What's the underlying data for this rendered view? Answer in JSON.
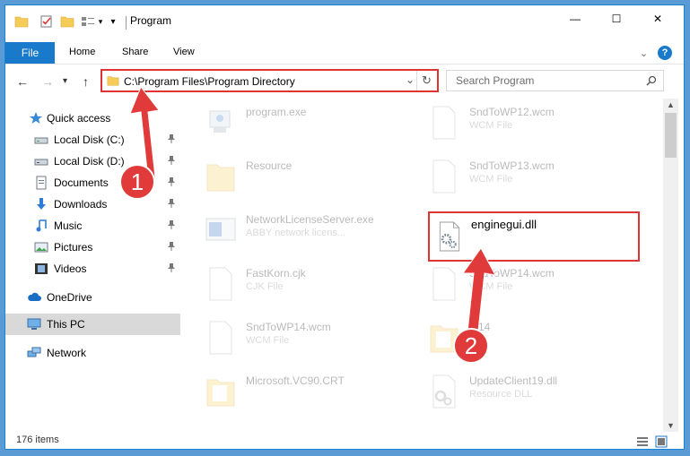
{
  "window": {
    "title": "Program",
    "controls": {
      "minimize": "—",
      "maximize": "☐",
      "close": "✕"
    }
  },
  "ribbon": {
    "file_label": "File",
    "tabs": [
      "Home",
      "Share",
      "View"
    ],
    "help_symbol": "?"
  },
  "navigation": {
    "back": "←",
    "forward": "→",
    "recent": "▾",
    "up": "↑",
    "address": "C:\\Program Files\\Program Directory",
    "dropdown": "⌄",
    "refresh": "↻",
    "search_placeholder": "Search Program"
  },
  "sidebar": {
    "items": [
      {
        "label": "Quick access",
        "icon": "star-icon"
      },
      {
        "label": "Local Disk (C:)",
        "icon": "drive-icon",
        "pinned": true
      },
      {
        "label": "Local Disk (D:)",
        "icon": "drive-icon",
        "pinned": true
      },
      {
        "label": "Documents",
        "icon": "documents-icon",
        "pinned": true
      },
      {
        "label": "Downloads",
        "icon": "downloads-icon",
        "pinned": true
      },
      {
        "label": "Music",
        "icon": "music-icon",
        "pinned": true
      },
      {
        "label": "Pictures",
        "icon": "pictures-icon",
        "pinned": true
      },
      {
        "label": "Videos",
        "icon": "videos-icon",
        "pinned": true
      },
      {
        "label": "OneDrive",
        "icon": "cloud-icon"
      },
      {
        "label": "This PC",
        "icon": "computer-icon",
        "selected": true
      },
      {
        "label": "Network",
        "icon": "network-icon"
      }
    ]
  },
  "files": {
    "items": [
      {
        "name": "program.exe",
        "type": ""
      },
      {
        "name": "SndToWP12.wcm",
        "type": "WCM File"
      },
      {
        "name": "Resource",
        "type": ""
      },
      {
        "name": "SndToWP13.wcm",
        "type": "WCM File"
      },
      {
        "name": "NetworkLicenseServer.exe",
        "type": "ABBY network licens..."
      },
      {
        "name": "enginegui.dll",
        "type": ""
      },
      {
        "name": "FastKorn.cjk",
        "type": "CJK File"
      },
      {
        "name": "SndToWP14.wcm",
        "type": "WCM File"
      },
      {
        "name": "SndToWP14.wcm",
        "type": "WCM File"
      },
      {
        "name": "...14",
        "type": ""
      },
      {
        "name": "Microsoft.VC90.CRT",
        "type": ""
      },
      {
        "name": "UpdateClient19.dll",
        "type": "Resource DLL"
      }
    ]
  },
  "status": {
    "count": "176 items"
  },
  "annotations": {
    "step1": "1",
    "step2": "2"
  },
  "colors": {
    "accent": "#1979ca",
    "highlight": "#e03434",
    "badge": "#e03a3a",
    "desktop": "#5b9bd5"
  }
}
